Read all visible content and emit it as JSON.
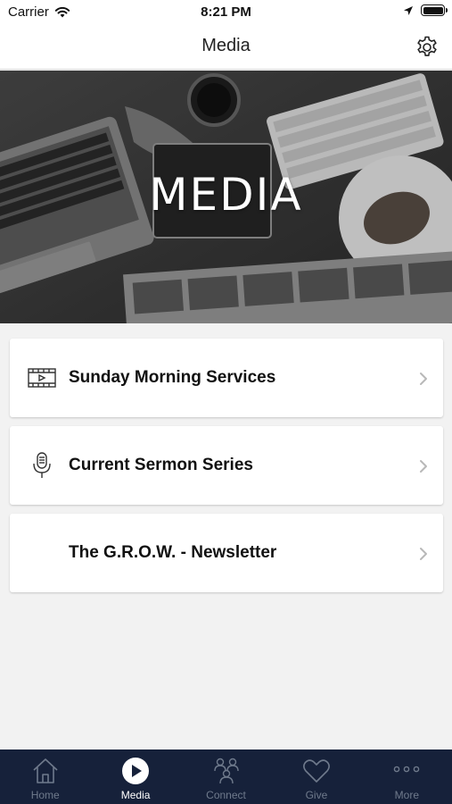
{
  "status_bar": {
    "carrier": "Carrier",
    "time": "8:21 PM"
  },
  "nav": {
    "title": "Media",
    "settings_icon": "gear-icon"
  },
  "hero": {
    "title": "MEDIA"
  },
  "list": {
    "items": [
      {
        "label": "Sunday Morning Services",
        "icon": "film-play-icon"
      },
      {
        "label": "Current Sermon Series",
        "icon": "microphone-icon"
      },
      {
        "label": "The G.R.O.W. - Newsletter",
        "icon": ""
      }
    ]
  },
  "tab_bar": {
    "items": [
      {
        "label": "Home",
        "icon": "home-icon",
        "active": false
      },
      {
        "label": "Media",
        "icon": "play-circle-icon",
        "active": true
      },
      {
        "label": "Connect",
        "icon": "people-icon",
        "active": false
      },
      {
        "label": "Give",
        "icon": "heart-icon",
        "active": false
      },
      {
        "label": "More",
        "icon": "more-dots-icon",
        "active": false
      }
    ]
  },
  "colors": {
    "tab_bar_bg": "#16213a",
    "tab_inactive": "#6f7a8c",
    "tab_active": "#ffffff",
    "background": "#f2f2f2"
  }
}
